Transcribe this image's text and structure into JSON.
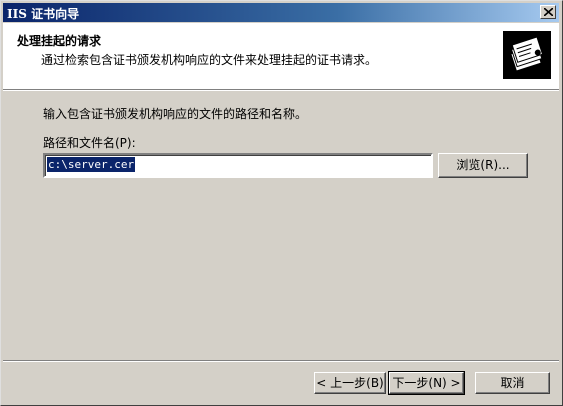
{
  "window": {
    "title": "IIS 证书向导"
  },
  "header": {
    "title": "处理挂起的请求",
    "subtitle": "通过检索包含证书颁发机构响应的文件来处理挂起的证书请求。",
    "icon": "certificate-icon"
  },
  "body": {
    "instruction": "输入包含证书颁发机构响应的文件的路径和名称。",
    "path_label": "路径和文件名(P):",
    "path_value": "c:\\server.cer",
    "browse_label": "浏览(R)..."
  },
  "footer": {
    "back_label": "< 上一步(B)",
    "next_label": "下一步(N) >",
    "cancel_label": "取消"
  },
  "colors": {
    "titlebar": "#0a246a",
    "selection": "#0a246a",
    "face": "#d4d0c8"
  }
}
